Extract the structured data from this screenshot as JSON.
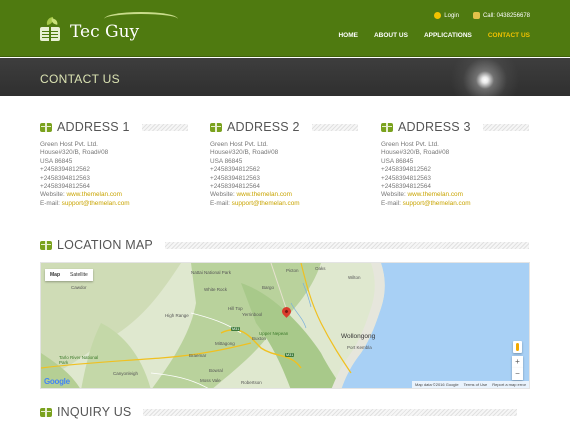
{
  "header": {
    "logo_text": "Tec Guy",
    "top_links": [
      {
        "label": "Login",
        "icon": "lock-icon"
      },
      {
        "label": "Call: 0438256678",
        "icon": "phone-icon"
      }
    ],
    "nav": [
      {
        "label": "HOME",
        "active": false
      },
      {
        "label": "ABOUT US",
        "active": false
      },
      {
        "label": "APPLICATIONS",
        "active": false
      },
      {
        "label": "CONTACT US",
        "active": true
      }
    ],
    "brand_color": "#4f7a10",
    "active_color": "#f2c200"
  },
  "page_title": "CONTACT US",
  "addresses": [
    {
      "heading": "ADDRESS 1",
      "lines": [
        "Green Host Pvt. Ltd.",
        "House#320/B, Road#08",
        "USA 86845",
        "+2458394812562",
        "+2458394812563",
        "+2458394812564"
      ],
      "website_label": "Website:",
      "website": "www.themelan.com",
      "email_label": "E-mail:",
      "email": "support@themelan.com"
    },
    {
      "heading": "ADDRESS 2",
      "lines": [
        "Green Host Pvt. Ltd.",
        "House#320/B, Road#08",
        "USA 86845",
        "+2458394812562",
        "+2458394812563",
        "+2458394812564"
      ],
      "website_label": "Website:",
      "website": "www.themelan.com",
      "email_label": "E-mail:",
      "email": "support@themelan.com"
    },
    {
      "heading": "ADDRESS 3",
      "lines": [
        "Green Host Pvt. Ltd.",
        "House#320/B, Road#08",
        "USA 86845",
        "+2458394812562",
        "+2458394812563",
        "+2458394812564"
      ],
      "website_label": "Website:",
      "website": "www.themelan.com",
      "email_label": "E-mail:",
      "email": "support@themelan.com"
    }
  ],
  "location": {
    "heading": "LOCATION MAP",
    "map_types": [
      "Map",
      "Satellite"
    ],
    "places": [
      "Wollongong",
      "Port Kembla",
      "Upper Nepean",
      "Nattai National Park",
      "White Rock",
      "Hill Top",
      "High Range",
      "Yerrinbool",
      "Bargo",
      "Picton",
      "Buxton",
      "Mittagong",
      "Braemar",
      "Bowral",
      "Moss Vale",
      "Canyonleigh",
      "Robertson",
      "Tarlo River National Park",
      "Oaks",
      "Cawdor",
      "Wilton"
    ],
    "zoom_in": "+",
    "zoom_out": "−",
    "footer": [
      "Map data ©2016 Google",
      "Terms of Use",
      "Report a map error"
    ],
    "google_logo": "Google"
  },
  "inquiry_heading": "INQUIRY US"
}
